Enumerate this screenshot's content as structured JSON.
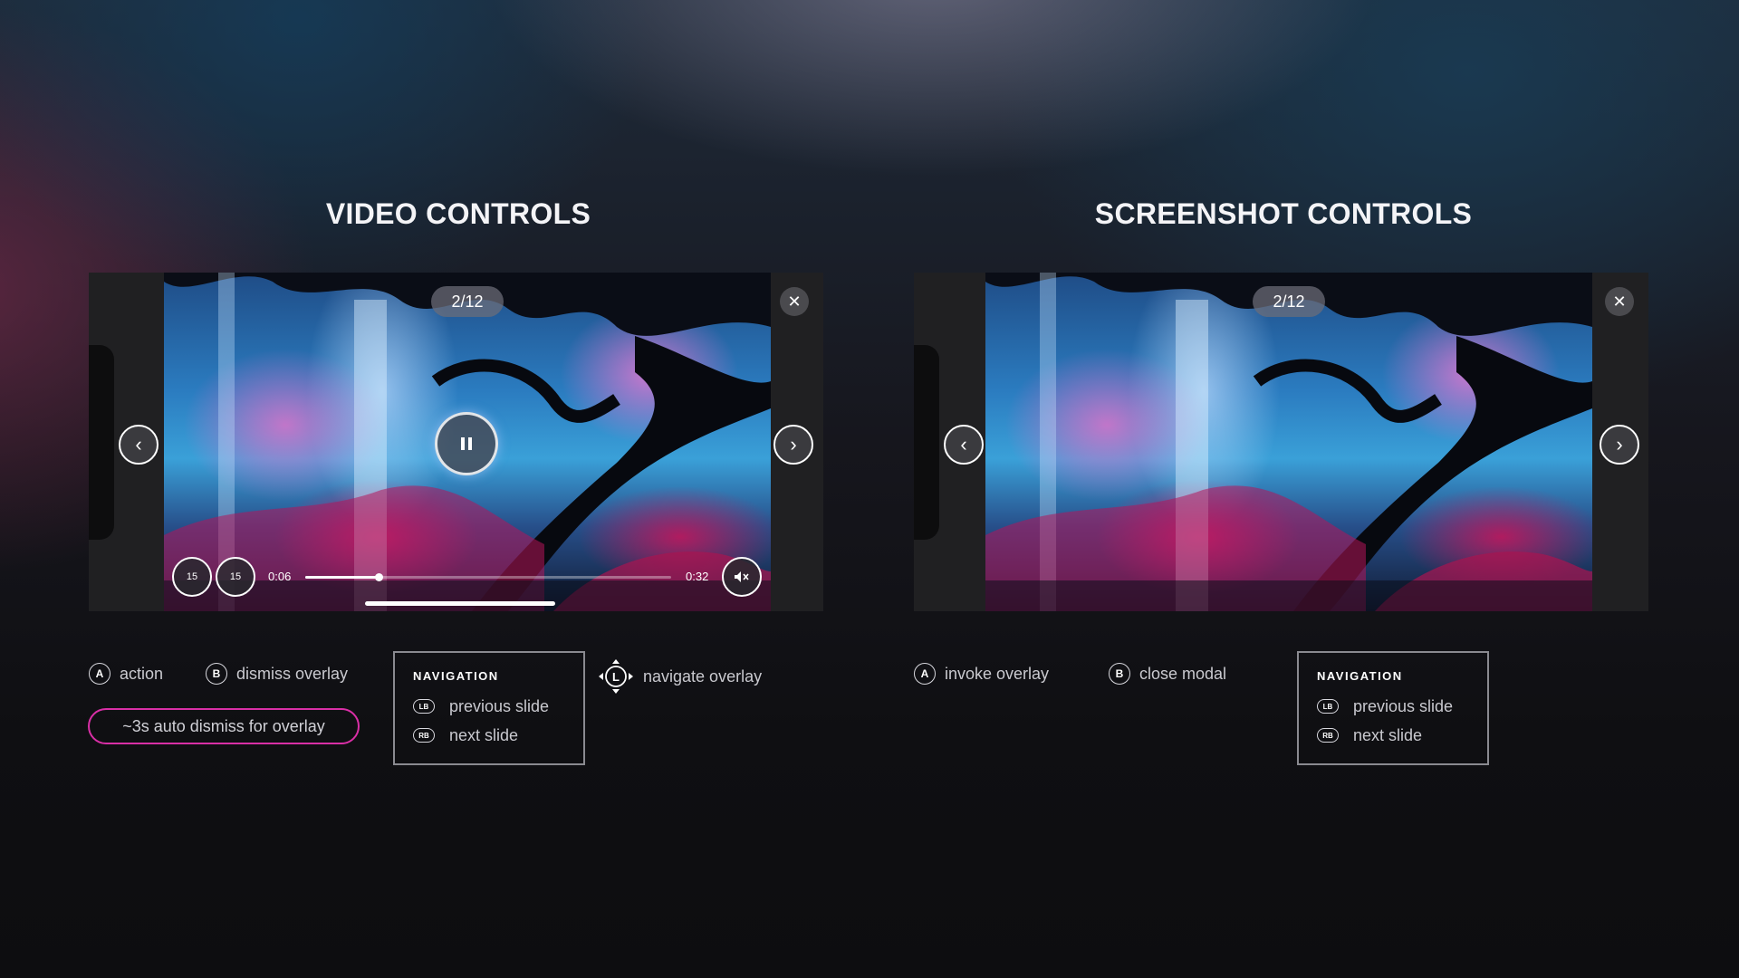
{
  "left_panel": {
    "title": "VIDEO CONTROLS",
    "counter": "2/12",
    "close_glyph": "✕",
    "prev_glyph": "‹",
    "next_glyph": "›",
    "current_time": "0:06",
    "duration": "0:32",
    "progress_fraction": 0.2,
    "rewind_label": "15",
    "forward_label": "15",
    "legend": {
      "a_button": "A",
      "a_label": "action",
      "b_button": "B",
      "b_label": "dismiss overlay",
      "stick_label": "L",
      "stick_text": "navigate overlay",
      "auto_dismiss": "~3s auto dismiss for overlay"
    },
    "navigation": {
      "heading": "NAVIGATION",
      "lb_glyph": "LB",
      "lb_label": "previous slide",
      "rb_glyph": "RB",
      "rb_label": "next slide"
    }
  },
  "right_panel": {
    "title": "SCREENSHOT CONTROLS",
    "counter": "2/12",
    "close_glyph": "✕",
    "prev_glyph": "‹",
    "next_glyph": "›",
    "legend": {
      "a_button": "A",
      "a_label": "invoke overlay",
      "b_button": "B",
      "b_label": "close modal"
    },
    "navigation": {
      "heading": "NAVIGATION",
      "lb_glyph": "LB",
      "lb_label": "previous slide",
      "rb_glyph": "RB",
      "rb_label": "next slide"
    }
  },
  "icons": {
    "close": "close-icon",
    "prev": "chevron-left-icon",
    "next": "chevron-right-icon",
    "pause": "pause-icon",
    "rewind": "rewind-15-icon",
    "forward": "forward-15-icon",
    "mute": "mute-icon",
    "a": "a-button-icon",
    "b": "b-button-icon",
    "lb": "lb-bumper-icon",
    "rb": "rb-bumper-icon",
    "stick": "left-stick-icon"
  },
  "colors": {
    "pill_border": "#d92fa6",
    "panel_bg": "#202022"
  }
}
